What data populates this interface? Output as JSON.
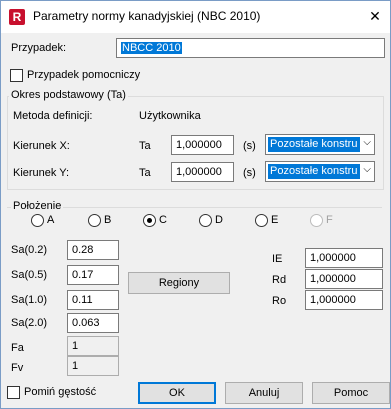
{
  "window": {
    "title": "Parametry normy kanadyjskiej (NBC 2010)",
    "close_glyph": "✕",
    "app_icon_letter": "R"
  },
  "case": {
    "label": "Przypadek:",
    "value": "NBCC 2010",
    "aux_label": "Przypadek pomocniczy"
  },
  "base_period": {
    "group_title": "Okres podstawowy (Ta)",
    "method_label": "Metoda definicji:",
    "method_value": "Użytkownika",
    "dir_x_label": "Kierunek X:",
    "dir_y_label": "Kierunek Y:",
    "ta_label": "Ta",
    "unit": "(s)",
    "x_value": "1,000000",
    "y_value": "1,000000",
    "x_select": "Pozostałe konstru",
    "y_select": "Pozostałe konstru"
  },
  "location": {
    "group_title": "Położenie",
    "options": [
      "A",
      "B",
      "C",
      "D",
      "E",
      "F"
    ],
    "selected": "C",
    "disabled": [
      "F"
    ]
  },
  "sa": {
    "sa02_label": "Sa(0.2)",
    "sa02_value": "0.28",
    "sa05_label": "Sa(0.5)",
    "sa05_value": "0.17",
    "sa10_label": "Sa(1.0)",
    "sa10_value": "0.11",
    "sa20_label": "Sa(2.0)",
    "sa20_value": "0.063",
    "fa_label": "Fa",
    "fa_value": "1",
    "fv_label": "Fv",
    "fv_value": "1"
  },
  "regions_button": "Regiony",
  "factors": {
    "ie_label": "IE",
    "ie_value": "1,000000",
    "rd_label": "Rd",
    "rd_value": "1,000000",
    "ro_label": "Ro",
    "ro_value": "1,000000"
  },
  "footer": {
    "skip_density": "Pomiń gęstość",
    "ok": "OK",
    "cancel": "Anuluj",
    "help": "Pomoc"
  },
  "colors": {
    "selection": "#0078d7",
    "default_button_border": "#0078d7"
  }
}
